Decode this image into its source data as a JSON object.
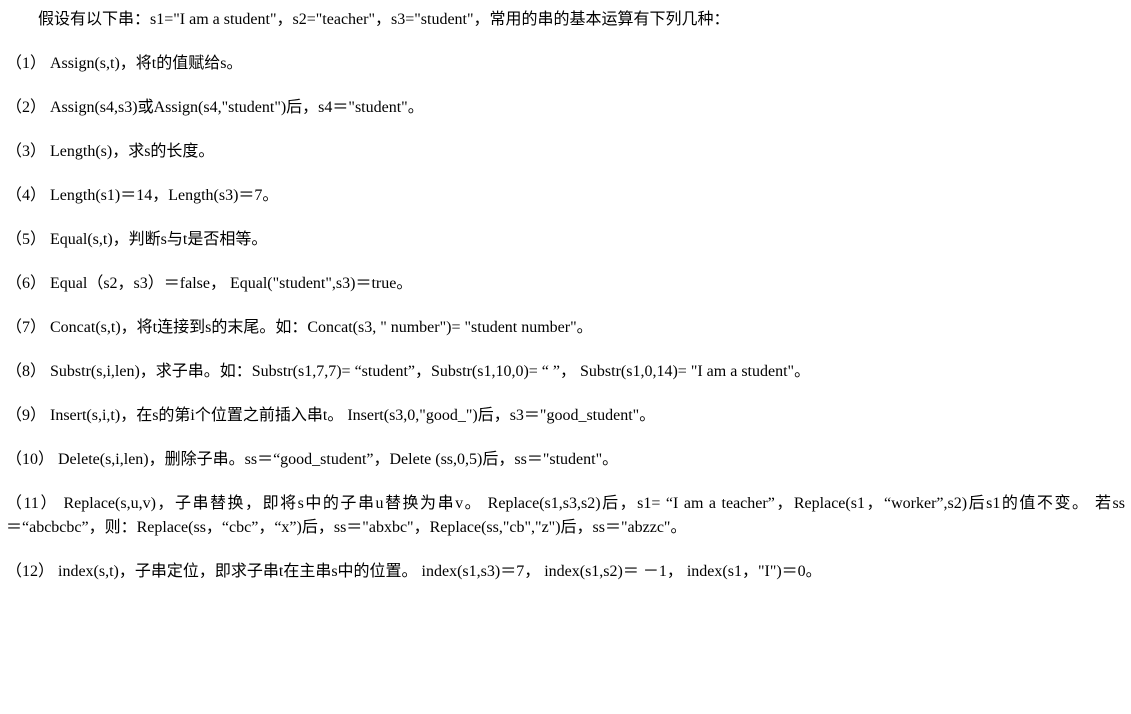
{
  "intro": "假设有以下串：s1=\"I am a student\"，s2=\"teacher\"，s3=\"student\"，常用的串的基本运算有下列几种：",
  "items": [
    "（1） Assign(s,t)，将t的值赋给s。",
    "（2） Assign(s4,s3)或Assign(s4,\"student\")后，s4＝\"student\"。",
    "（3） Length(s)，求s的长度。",
    "（4） Length(s1)＝14，Length(s3)＝7。",
    "（5） Equal(s,t)，判断s与t是否相等。",
    "（6） Equal（s2，s3）＝false， Equal(\"student\",s3)＝true。",
    "（7） Concat(s,t)，将t连接到s的末尾。如：Concat(s3, \" number\")= \"student number\"。",
    "（8） Substr(s,i,len)，求子串。如：Substr(s1,7,7)= “student”，Substr(s1,10,0)= “ ”，  Substr(s1,0,14)= \"I am a student\"。",
    "（9） Insert(s,i,t)，在s的第i个位置之前插入串t。 Insert(s3,0,\"good_\")后，s3＝\"good_student\"。",
    "（10） Delete(s,i,len)，删除子串。ss＝“good_student”，Delete (ss,0,5)后，ss＝\"student\"。",
    "（11） Replace(s,u,v)，子串替换，即将s中的子串u替换为串v。 Replace(s1,s3,s2)后，s1= “I am a teacher”，Replace(s1，“worker”,s2)后s1的值不变。 若ss＝“abcbcbc”，则：Replace(ss，“cbc”，“x”)后，ss＝\"abxbc\"，Replace(ss,\"cb\",\"z\")后，ss＝\"abzzc\"。",
    "（12） index(s,t)，子串定位，即求子串t在主串s中的位置。 index(s1,s3)＝7， index(s1,s2)＝ －1， index(s1，\"I\")＝0。"
  ]
}
